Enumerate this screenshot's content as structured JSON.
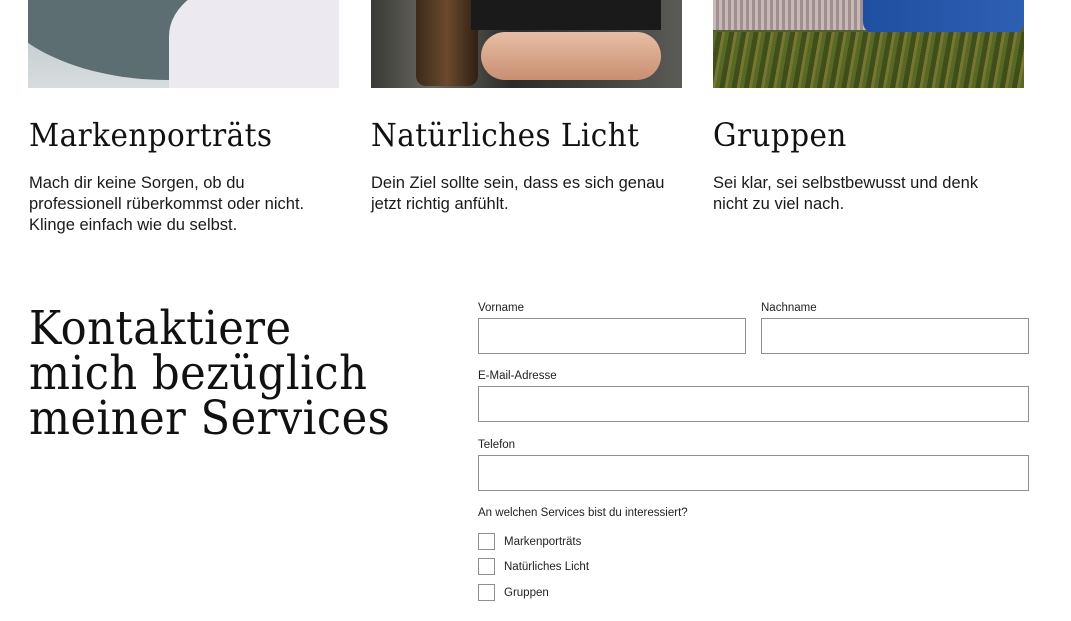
{
  "services": [
    {
      "title": "Markenporträts",
      "description": "Mach dir keine Sorgen, ob du professionell rüberkommst oder nicht. Klinge einfach wie du selbst."
    },
    {
      "title": "Natürliches Licht",
      "description": "Dein Ziel sollte sein, dass es sich genau jetzt richtig anfühlt."
    },
    {
      "title": "Gruppen",
      "description": "Sei klar, sei selbstbewusst und denk nicht zu viel nach."
    }
  ],
  "contact": {
    "heading": "Kontaktiere mich bezüglich meiner Services",
    "form": {
      "first_name_label": "Vorname",
      "first_name_value": "",
      "last_name_label": "Nachname",
      "last_name_value": "",
      "email_label": "E-Mail-Adresse",
      "email_value": "",
      "phone_label": "Telefon",
      "phone_value": "",
      "services_question": "An welchen Services bist du interessiert?",
      "options": [
        {
          "label": "Markenporträts",
          "checked": false
        },
        {
          "label": "Natürliches Licht",
          "checked": false
        },
        {
          "label": "Gruppen",
          "checked": false
        }
      ]
    }
  }
}
